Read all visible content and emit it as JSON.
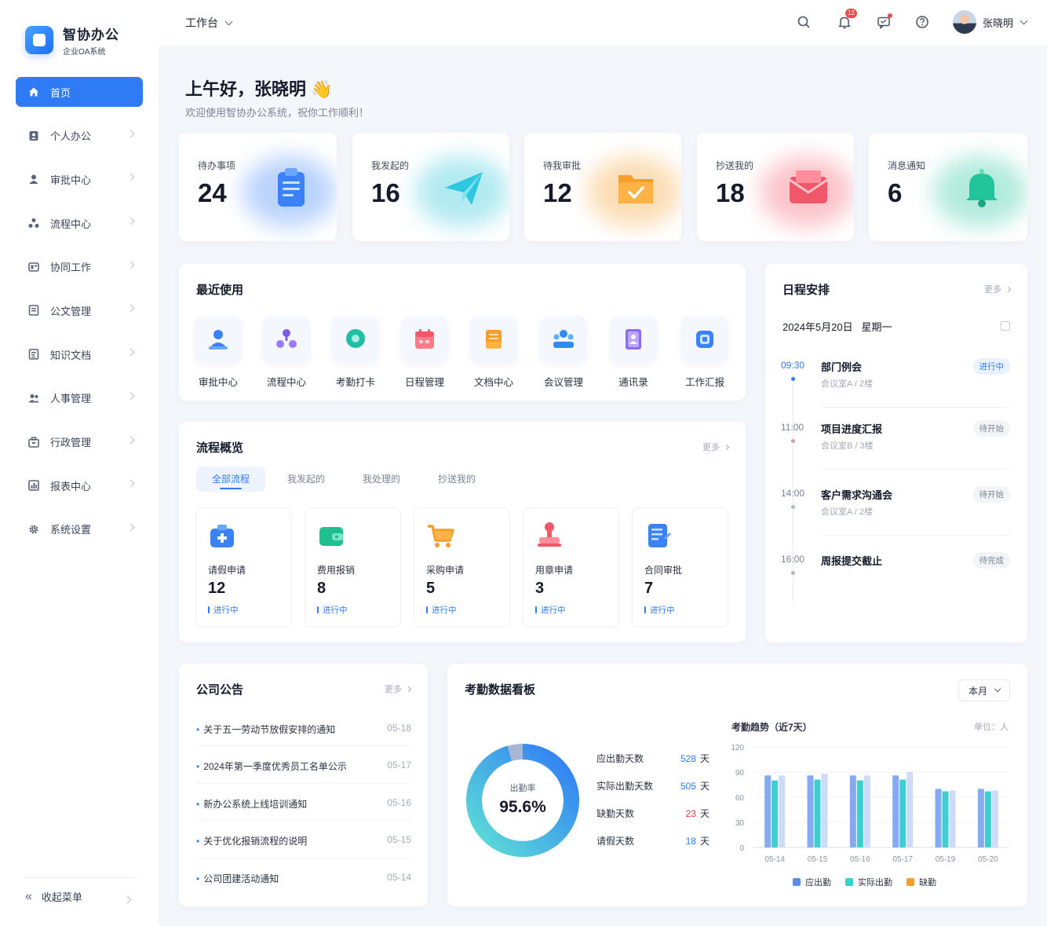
{
  "app": {
    "name": "智协办公",
    "subtitle": "企业OA系统"
  },
  "sidebar": {
    "items": [
      {
        "label": "首页",
        "icon": "home-icon"
      },
      {
        "label": "个人办公",
        "icon": "user-lock-icon"
      },
      {
        "label": "审批中心",
        "icon": "user-icon"
      },
      {
        "label": "流程中心",
        "icon": "flow-icon"
      },
      {
        "label": "协同工作",
        "icon": "collab-icon"
      },
      {
        "label": "公文管理",
        "icon": "document-icon"
      },
      {
        "label": "知识文档",
        "icon": "knowledge-icon"
      },
      {
        "label": "人事管理",
        "icon": "people-icon"
      },
      {
        "label": "行政管理",
        "icon": "briefcase-icon"
      },
      {
        "label": "报表中心",
        "icon": "report-icon"
      },
      {
        "label": "系统设置",
        "icon": "gear-icon"
      }
    ],
    "collapse_label": "收起菜单"
  },
  "topbar": {
    "workspace": "工作台",
    "notification_count": "12",
    "user_name": "张晓明"
  },
  "greeting": {
    "title": "上午好，张晓明 👋",
    "subtitle": "欢迎使用智协办公系统，祝你工作顺利！"
  },
  "stats": [
    {
      "label": "待办事项",
      "value": "24",
      "icon": "clipboard-icon",
      "color": "#3b82f6"
    },
    {
      "label": "我发起的",
      "value": "16",
      "icon": "paper-plane-icon",
      "color": "#22c3d6"
    },
    {
      "label": "待我审批",
      "value": "12",
      "icon": "folder-check-icon",
      "color": "#f59e2b"
    },
    {
      "label": "抄送我的",
      "value": "18",
      "icon": "envelope-icon",
      "color": "#f0586a"
    },
    {
      "label": "消息通知",
      "value": "6",
      "icon": "bell-icon",
      "color": "#22c59a"
    }
  ],
  "recent": {
    "title": "最近使用",
    "items": [
      {
        "label": "审批中心",
        "icon": "approval-icon"
      },
      {
        "label": "流程中心",
        "icon": "flow-icon"
      },
      {
        "label": "考勤打卡",
        "icon": "location-icon"
      },
      {
        "label": "日程管理",
        "icon": "calendar-icon"
      },
      {
        "label": "文档中心",
        "icon": "folder-icon"
      },
      {
        "label": "会议管理",
        "icon": "meeting-icon"
      },
      {
        "label": "通讯录",
        "icon": "contacts-icon"
      },
      {
        "label": "工作汇报",
        "icon": "report-icon"
      }
    ]
  },
  "process": {
    "title": "流程概览",
    "more": "更多",
    "tabs": [
      "全部流程",
      "我发起的",
      "我处理的",
      "抄送我的"
    ],
    "items": [
      {
        "name": "请假申请",
        "count": "12",
        "status": "进行中",
        "icon": "medkit-icon"
      },
      {
        "name": "费用报销",
        "count": "8",
        "status": "进行中",
        "icon": "wallet-icon"
      },
      {
        "name": "采购申请",
        "count": "5",
        "status": "进行中",
        "icon": "cart-icon"
      },
      {
        "name": "用章申请",
        "count": "3",
        "status": "进行中",
        "icon": "stamp-icon"
      },
      {
        "name": "合同审批",
        "count": "7",
        "status": "进行中",
        "icon": "contract-icon"
      }
    ]
  },
  "schedule": {
    "title": "日程安排",
    "more": "更多",
    "date": "2024年5月20日",
    "weekday": "星期一",
    "items": [
      {
        "time": "09:30",
        "title": "部门例会",
        "location": "会议室A / 2楼",
        "status": "进行中"
      },
      {
        "time": "11:00",
        "title": "项目进度汇报",
        "location": "会议室B / 3楼",
        "status": "待开始"
      },
      {
        "time": "14:00",
        "title": "客户需求沟通会",
        "location": "会议室A / 2楼",
        "status": "待开始"
      },
      {
        "time": "16:00",
        "title": "周报提交截止",
        "location": "",
        "status": "待完成"
      }
    ]
  },
  "notices": {
    "title": "公司公告",
    "more": "更多",
    "items": [
      {
        "title": "关于五一劳动节放假安排的通知",
        "date": "05-18"
      },
      {
        "title": "2024年第一季度优秀员工名单公示",
        "date": "05-17"
      },
      {
        "title": "新办公系统上线培训通知",
        "date": "05-16"
      },
      {
        "title": "关于优化报销流程的说明",
        "date": "05-15"
      },
      {
        "title": "公司团建活动通知",
        "date": "05-14"
      }
    ]
  },
  "attendance": {
    "title": "考勤数据看板",
    "period": "本月",
    "rate_label": "出勤率",
    "rate": "95.6%",
    "rate_value": 95.6,
    "metrics": [
      {
        "label": "应出勤天数",
        "value": "528",
        "unit": "天"
      },
      {
        "label": "实际出勤天数",
        "value": "505",
        "unit": "天"
      },
      {
        "label": "缺勤天数",
        "value": "23",
        "unit": "天"
      },
      {
        "label": "请假天数",
        "value": "18",
        "unit": "天"
      }
    ],
    "trend_title": "考勤趋势（近7天）",
    "trend_unit": "单位：人"
  },
  "chart_data": {
    "type": "bar",
    "title": "考勤趋势（近7天）",
    "categories": [
      "05-14",
      "05-15",
      "05-16",
      "05-17",
      "05-19",
      "05-20"
    ],
    "series": [
      {
        "name": "应出勤",
        "values": [
          86,
          86,
          86,
          86,
          70,
          70
        ],
        "color": "#5b8def"
      },
      {
        "name": "实际出勤",
        "values": [
          80,
          81,
          80,
          81,
          67,
          67
        ],
        "color": "#3ccfd0"
      },
      {
        "name": "缺勤",
        "values": [
          86,
          88,
          86,
          90,
          68,
          68
        ],
        "color": "#f59e2b"
      }
    ],
    "ylim": [
      0,
      120
    ],
    "yticks": [
      0,
      30,
      60,
      90,
      120
    ],
    "ylabel": "单位：人",
    "legend": "bottom",
    "grid": true
  }
}
